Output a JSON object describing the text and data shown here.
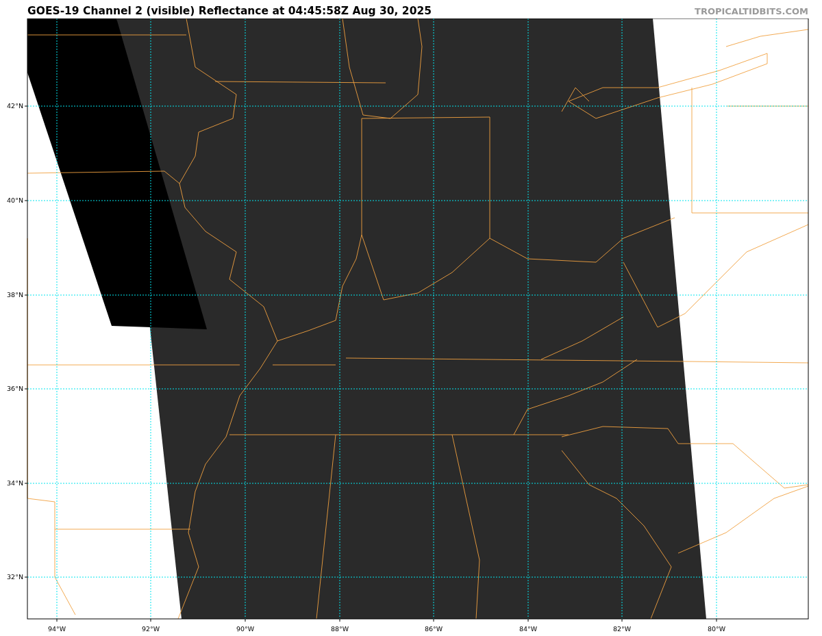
{
  "header": {
    "title": "GOES-19 Channel 2 (visible) Reflectance at 04:45:58Z Aug 30, 2025",
    "credit": "TROPICALTIDBITS.COM"
  },
  "map": {
    "lat_labels": [
      "42°N",
      "40°N",
      "38°N",
      "36°N",
      "34°N",
      "32°N"
    ],
    "lon_labels": [
      "94°W",
      "92°W",
      "90°W",
      "88°W",
      "86°W",
      "84°W",
      "82°W",
      "80°W"
    ]
  }
}
